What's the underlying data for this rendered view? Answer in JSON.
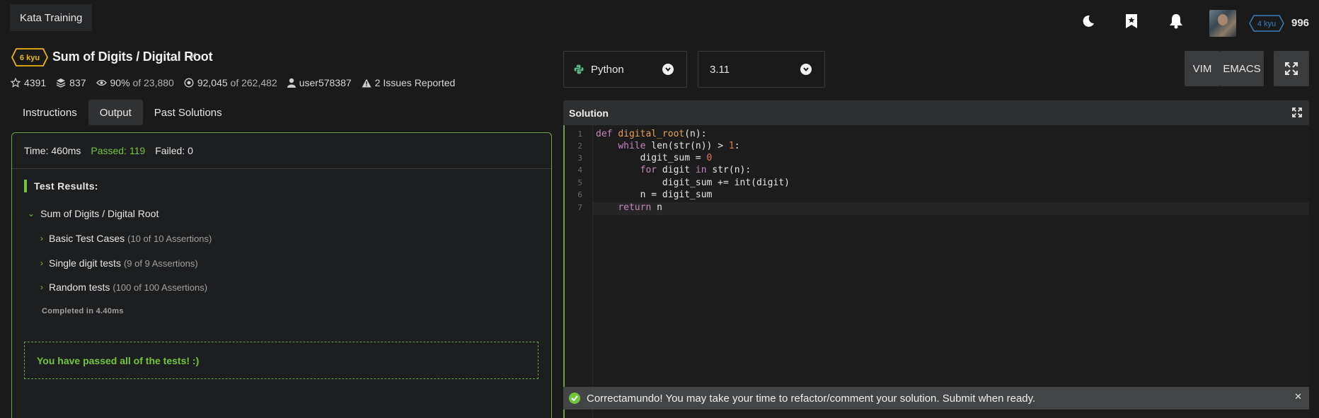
{
  "app": {
    "title": "Kata Training"
  },
  "user": {
    "rank": "4 kyu",
    "honor": "996"
  },
  "kata": {
    "rank": "6 kyu",
    "title": "Sum of Digits / Digital Root",
    "stats": {
      "stars": "4391",
      "collections": "837",
      "satisfaction": "90%",
      "satisfaction_of": "of 23,880",
      "completed": "92,045",
      "completed_of": "of 262,482",
      "author": "user578387",
      "issues": "2 Issues Reported"
    }
  },
  "tabs": [
    {
      "label": "Instructions",
      "active": false
    },
    {
      "label": "Output",
      "active": true
    },
    {
      "label": "Past Solutions",
      "active": false
    }
  ],
  "output": {
    "time": "Time: 460ms",
    "passed": "Passed: 119",
    "failed": "Failed: 0",
    "results_label": "Test Results:",
    "root": "Sum of Digits / Digital Root",
    "groups": [
      {
        "name": "Basic Test Cases",
        "detail": "(10 of 10 Assertions)"
      },
      {
        "name": "Single digit tests",
        "detail": "(9 of 9 Assertions)"
      },
      {
        "name": "Random tests",
        "detail": "(100 of 100 Assertions)"
      }
    ],
    "completed": "Completed in 4.40ms",
    "pass_message": "You have passed all of the tests! :)"
  },
  "editor": {
    "language": "Python",
    "version": "3.11",
    "vim_label": "VIM",
    "emacs_label": "EMACS",
    "solution_label": "Solution",
    "line_numbers": [
      "1",
      "2",
      "3",
      "4",
      "5",
      "6",
      "7"
    ]
  },
  "toast": {
    "message": "Correctamundo! You may take your time to refactor/comment your solution. Submit when ready."
  },
  "colors": {
    "accent_green": "#73c53a",
    "kyu_yellow": "#ecb613",
    "kyu_blue": "#3c7ebb"
  }
}
